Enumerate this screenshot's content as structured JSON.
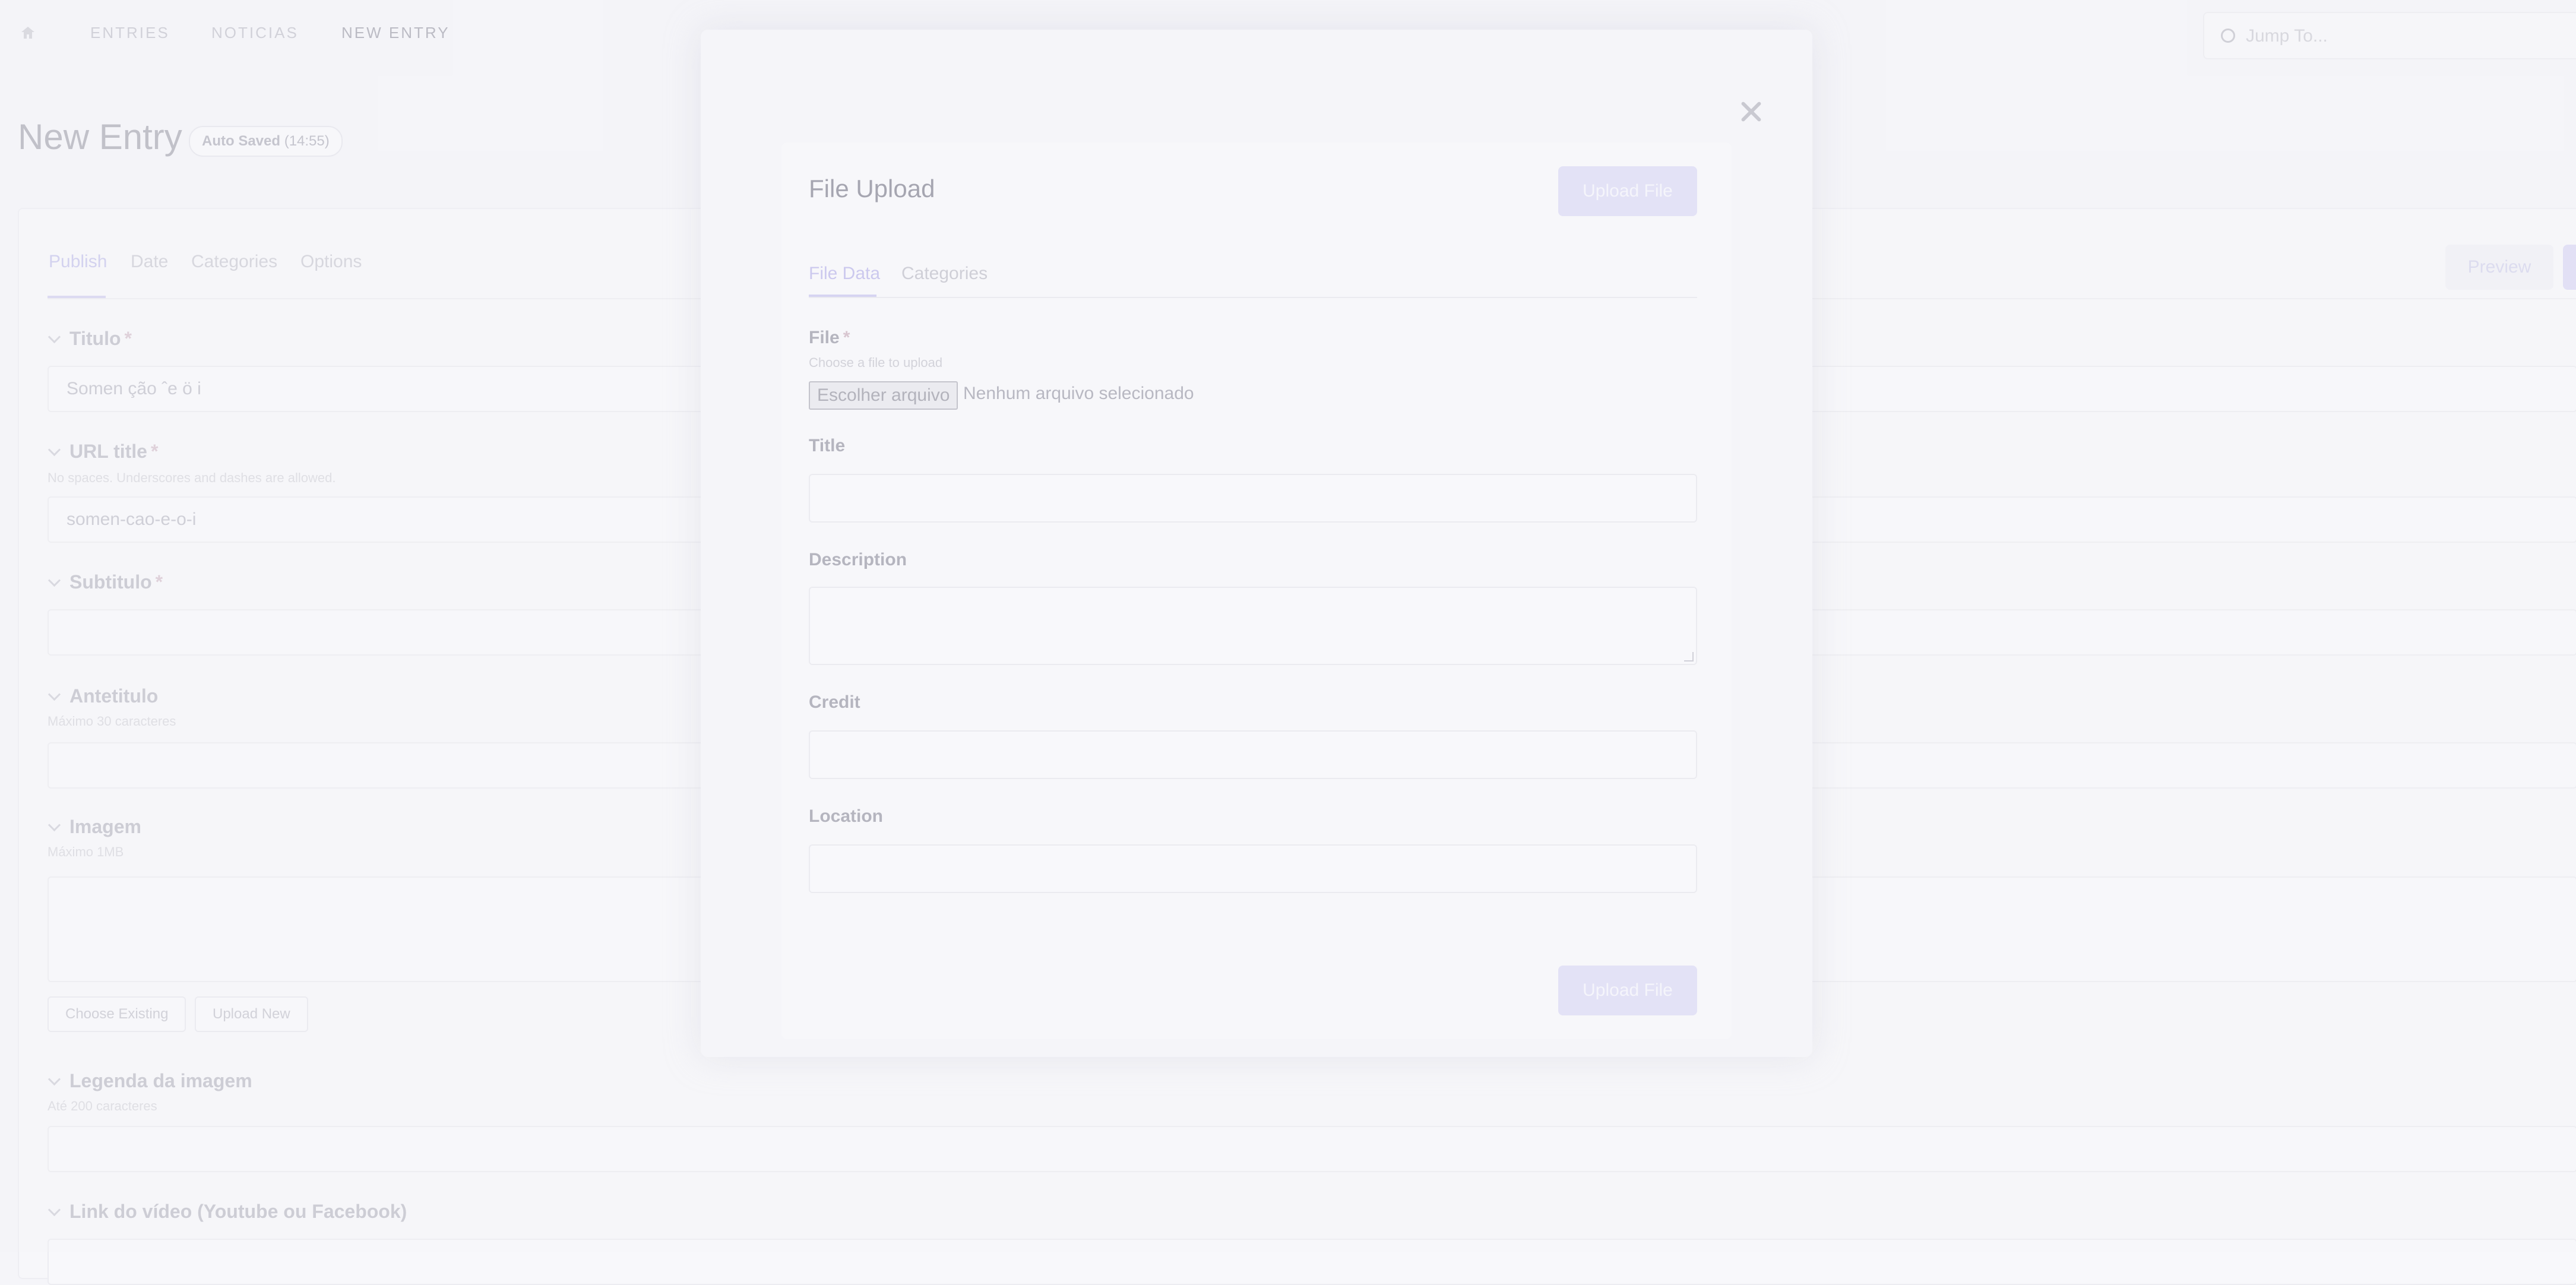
{
  "nav": {
    "items": [
      {
        "label": "ENTRIES"
      },
      {
        "label": "NOTICIAS"
      },
      {
        "label": "NEW ENTRY"
      }
    ],
    "jump_placeholder": "Jump To..."
  },
  "page": {
    "title": "New Entry",
    "autosave_label": "Auto Saved",
    "autosave_time": "(14:55)"
  },
  "tabs": [
    "Publish",
    "Date",
    "Categories",
    "Options"
  ],
  "actions": {
    "preview": "Preview"
  },
  "fields": {
    "titulo": {
      "label": "Titulo",
      "required": "*",
      "value": "Somen ção ˆe ö i"
    },
    "url_title": {
      "label": "URL title",
      "required": "*",
      "hint": "No spaces. Underscores and dashes are allowed.",
      "value": "somen-cao-e-o-i"
    },
    "subtitulo": {
      "label": "Subtitulo",
      "required": "*"
    },
    "antetitulo": {
      "label": "Antetitulo",
      "hint": "Máximo 30 caracteres"
    },
    "imagem": {
      "label": "Imagem",
      "hint": "Máximo 1MB",
      "choose_existing": "Choose Existing",
      "upload_new": "Upload New"
    },
    "legenda": {
      "label": "Legenda da imagem",
      "hint": "Até 200 caracteres"
    },
    "link_video": {
      "label": "Link do vídeo (Youtube ou Facebook)"
    }
  },
  "modal": {
    "title": "File Upload",
    "upload_button": "Upload File",
    "tabs": [
      "File Data",
      "Categories"
    ],
    "file": {
      "label": "File",
      "required": "*",
      "hint": "Choose a file to upload",
      "choose_label": "Escolher arquivo",
      "none_label": "Nenhum arquivo selecionado"
    },
    "title_field": {
      "label": "Title",
      "value": ""
    },
    "description_field": {
      "label": "Description",
      "value": ""
    },
    "credit_field": {
      "label": "Credit",
      "value": ""
    },
    "location_field": {
      "label": "Location",
      "value": ""
    }
  }
}
